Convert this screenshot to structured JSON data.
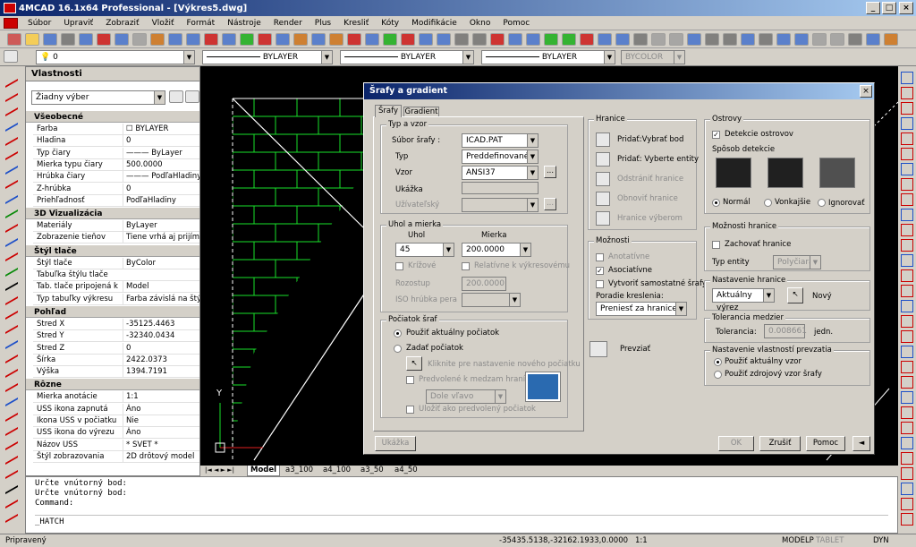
{
  "window": {
    "title": "4MCAD 16.1x64 Professional - [Výkres5.dwg]",
    "min": "_",
    "max": "□",
    "close": "×"
  },
  "menu": [
    "Súbor",
    "Upraviť",
    "Zobraziť",
    "Vložiť",
    "Formát",
    "Nástroje",
    "Render",
    "Plus",
    "Kresliť",
    "Kóty",
    "Modifikácie",
    "Okno",
    "Pomoc"
  ],
  "layerbar": {
    "layer": "0",
    "color": "BYLAYER",
    "linetype": "BYLAYER",
    "lineweight": "BYLAYER",
    "plotstyle": "BYCOLOR"
  },
  "properties": {
    "title": "Vlastnosti",
    "selection": "Žiadny výber",
    "groups": [
      {
        "name": "Všeobecné",
        "rows": [
          [
            "Farba",
            "☐ BYLAYER"
          ],
          [
            "Hladina",
            "0"
          ],
          [
            "Typ čiary",
            "——— ByLayer"
          ],
          [
            "Mierka typu čiary",
            "500.0000"
          ],
          [
            "Hrúbka čiary",
            "——— PodľaHladiny"
          ],
          [
            "Z-hrúbka",
            "0"
          ],
          [
            "Priehľadnosť",
            "PodľaHladiny"
          ]
        ]
      },
      {
        "name": "3D Vizualizácia",
        "rows": [
          [
            "Materiály",
            "ByLayer"
          ],
          [
            "Zobrazenie tieňov",
            "Tiene vrhá aj prijíma"
          ]
        ]
      },
      {
        "name": "Štýl tlače",
        "rows": [
          [
            "Štýl tlače",
            "ByColor"
          ],
          [
            "Tabuľka štýlu tlače",
            ""
          ],
          [
            "Tab. tlače pripojená k",
            "Model"
          ],
          [
            "Typ tabuľky výkresu",
            "Farba závislá na štý..."
          ]
        ]
      },
      {
        "name": "Pohľad",
        "rows": [
          [
            "Stred X",
            "-35125.4463"
          ],
          [
            "Stred Y",
            "-32340.0434"
          ],
          [
            "Stred Z",
            "0"
          ],
          [
            "Šírka",
            "2422.0373"
          ],
          [
            "Výška",
            "1394.7191"
          ]
        ]
      },
      {
        "name": "Rôzne",
        "rows": [
          [
            "Mierka anotácie",
            "1:1"
          ],
          [
            "USS ikona zapnutá",
            "Áno"
          ],
          [
            "Ikona USS v počiatku",
            "Nie"
          ],
          [
            "USS ikona do výrezu",
            "Áno"
          ],
          [
            "Názov USS",
            "* SVET *"
          ],
          [
            "Štýl zobrazovania",
            "2D drôtový model"
          ]
        ]
      }
    ]
  },
  "layout_tabs": [
    "Model",
    "a3_100",
    "a4_100",
    "a3_50",
    "a4_50"
  ],
  "command": {
    "lines": [
      "Určte vnútorný bod:",
      "Určte vnútorný bod:",
      "Command:"
    ],
    "input": "_HATCH"
  },
  "status": {
    "left": "Pripravený",
    "coords": "-35435.5138,-32162.1933,0.0000",
    "scale": "1:1",
    "model": "MODELP",
    "tablet": "TABLET",
    "dyn": "DYN"
  },
  "dialog": {
    "title": "Šrafy a gradient",
    "tabs": [
      "Šrafy",
      "Gradient"
    ],
    "typ_vzor": {
      "label": "Typ a vzor",
      "subor_label": "Súbor šrafy :",
      "subor": "ICAD.PAT",
      "typ_label": "Typ",
      "typ": "Preddefinované",
      "vzor_label": "Vzor",
      "vzor": "ANSI37",
      "ukazka": "Ukážka",
      "uzivatelsky": "Užívateľský",
      "browse": "..."
    },
    "uhol_mierka": {
      "label": "Uhol a mierka",
      "uhol_label": "Uhol",
      "uhol": "45",
      "mierka_label": "Mierka",
      "mierka": "200.0000",
      "krizove": "Krížové",
      "relativne": "Relatívne k výkresovému",
      "rozostup_label": "Rozostup",
      "rozostup": "200.0000",
      "iso_label": "ISO hrúbka pera"
    },
    "pociatok": {
      "label": "Počiatok šraf",
      "aktualny": "Použiť aktuálny počiatok",
      "zadat": "Zadať počiatok",
      "kliknite": "Kliknite pre nastavenie nového počiatku",
      "predvoleny": "Predvolené k medzam hraníc",
      "pozicia": "Dole vľavo",
      "ulozit": "Uložiť ako predvolený počiatok"
    },
    "hranice": {
      "label": "Hranice",
      "pridat_bod": "Pridať:Vybrať bod",
      "pridat_entity": "Pridať: Vyberte entity",
      "odstranit": "Odstrániť hranice",
      "obnovit": "Obnoviť hranice",
      "vyberom": "Hranice výberom"
    },
    "moznosti": {
      "label": "Možnosti",
      "anotativne": "Anotatívne",
      "asociativne": "Asociatívne",
      "samostatne": "Vytvoriť samostatné šrafy",
      "poradie_label": "Poradie kreslenia:",
      "poradie": "Preniesť za hranice"
    },
    "prevziat": "Prevziať",
    "ostrovy": {
      "label": "Ostrovy",
      "detekcia": "Detekcie ostrovov",
      "sposob": "Spôsob detekcie",
      "normal": "Normál",
      "vonkajsie": "Vonkajšie",
      "ignorovat": "Ignorovať"
    },
    "moznosti_hranice": {
      "label": "Možnosti hranice",
      "zachovat": "Zachovať hranice",
      "typ_label": "Typ entity",
      "typ": "Polyčiara"
    },
    "nastavenie_hranice": {
      "label": "Nastavenie hranice",
      "value": "Aktuálny výrez",
      "novy": "Nový"
    },
    "tolerancia": {
      "label": "Tolerancia medzier",
      "tol_label": "Tolerancia:",
      "tol": "0.008661",
      "jedn": "jedn."
    },
    "prevzatie": {
      "label": "Nastavenie vlastností prevzatia",
      "aktualny": "Použiť aktuálny vzor",
      "zdrojovy": "Použiť zdrojový vzor šrafy"
    },
    "buttons": {
      "ukazka": "Ukážka",
      "ok": "OK",
      "zrusit": "Zrušiť",
      "pomoc": "Pomoc",
      "back": "◄"
    }
  },
  "colors": {
    "title_start": "#0a246a",
    "title_end": "#a6caf0",
    "hatch": "#19e02a",
    "canvas": "#000000",
    "face": "#d4d0c8"
  }
}
